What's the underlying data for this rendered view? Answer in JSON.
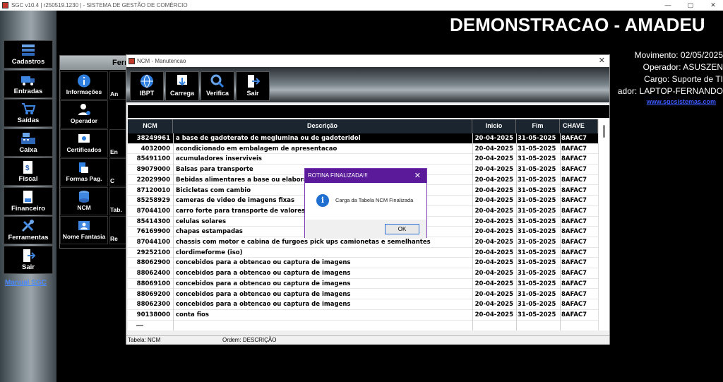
{
  "app": {
    "title": "SGC v10.4 | r250519.1230 | - SISTEMA DE GESTÃO DE COMÉRCIO",
    "win_controls": [
      "—",
      "▢",
      "✕"
    ]
  },
  "sidebar": {
    "items": [
      {
        "label": "Cadastros",
        "icon": "database-stack-icon"
      },
      {
        "label": "Entradas",
        "icon": "truck-icon"
      },
      {
        "label": "Saídas",
        "icon": "cart-icon"
      },
      {
        "label": "Caixa",
        "icon": "cash-register-icon"
      },
      {
        "label": "Fiscal",
        "icon": "fiscal-document-icon"
      },
      {
        "label": "Financeiro",
        "icon": "finance-document-icon"
      },
      {
        "label": "Ferramentas",
        "icon": "tools-icon"
      },
      {
        "label": "Sair",
        "icon": "exit-door-icon"
      }
    ],
    "manual_link": "Manual SGC"
  },
  "header": {
    "company": "DEMONSTRACAO - AMADEU",
    "movimento": "Movimento: 02/05/2025",
    "operador": "Operador: ASUSZEN",
    "cargo": "Cargo: Suporte de TI",
    "computador": "ador: LAPTOP-FERNANDO",
    "site": "www.sgcsistemas.com"
  },
  "ferramentas": {
    "title": "Ferr",
    "items": [
      {
        "label": "Informações",
        "side": "An"
      },
      {
        "label": "Operador",
        "side": ""
      },
      {
        "label": "Certificados",
        "side": "En"
      },
      {
        "label": "Formas Pag.",
        "side": "C"
      },
      {
        "label": "NCM",
        "side": "Tab."
      },
      {
        "label": "Nome Fantasia",
        "side": "Re"
      }
    ]
  },
  "ncm_window": {
    "title": "NCM - Manutencao",
    "close": "✕",
    "toolbar": [
      {
        "label": "IBPT",
        "icon": "globe-icon"
      },
      {
        "label": "Carrega",
        "icon": "download-icon"
      },
      {
        "label": "Verifica",
        "icon": "magnifier-icon"
      },
      {
        "label": "Sair",
        "icon": "exit-door-icon"
      }
    ],
    "columns": [
      "NCM",
      "Descrição",
      "Inicio",
      "Fim",
      "CHAVE"
    ],
    "rows": [
      [
        "38249961",
        "a base de gadoterato de meglumina ou de gadoteridol",
        "20-04-2025",
        "31-05-2025",
        "8AFAC7"
      ],
      [
        "4032000",
        "acondicionado em embalagem de apresentacao",
        "20-04-2025",
        "31-05-2025",
        "8AFAC7"
      ],
      [
        "85491100",
        "acumuladores inserviveis",
        "20-04-2025",
        "31-05-2025",
        "8AFAC7"
      ],
      [
        "89079000",
        "Balsas para transporte",
        "20-04-2025",
        "31-05-2025",
        "8AFAC7"
      ],
      [
        "22029900",
        "Bebidas alimentares a base ou elaborada",
        "20-04-2025",
        "31-05-2025",
        "8AFAC7"
      ],
      [
        "87120010",
        "Bicicletas com cambio",
        "20-04-2025",
        "31-05-2025",
        "8AFAC7"
      ],
      [
        "85258929",
        "cameras de video de imagens fixas",
        "20-04-2025",
        "31-05-2025",
        "8AFAC7"
      ],
      [
        "87044100",
        "carro forte para transporte de valores",
        "20-04-2025",
        "31-05-2025",
        "8AFAC7"
      ],
      [
        "85414300",
        "celulas solares",
        "20-04-2025",
        "31-05-2025",
        "8AFAC7"
      ],
      [
        "76169900",
        "chapas estampadas",
        "20-04-2025",
        "31-05-2025",
        "8AFAC7"
      ],
      [
        "87044100",
        "chassis com motor e cabina de furgoes pick ups camionetas e semelhantes",
        "20-04-2025",
        "31-05-2025",
        "8AFAC7"
      ],
      [
        "29252100",
        "clordimeforme (iso)",
        "20-04-2025",
        "31-05-2025",
        "8AFAC7"
      ],
      [
        "88062900",
        "concebidos para a obtencao ou captura de imagens",
        "20-04-2025",
        "31-05-2025",
        "8AFAC7"
      ],
      [
        "88062400",
        "concebidos para a obtencao ou captura de imagens",
        "20-04-2025",
        "31-05-2025",
        "8AFAC7"
      ],
      [
        "88069100",
        "concebidos para a obtencao ou captura de imagens",
        "20-04-2025",
        "31-05-2025",
        "8AFAC7"
      ],
      [
        "88069200",
        "concebidos para a obtencao ou captura de imagens",
        "20-04-2025",
        "31-05-2025",
        "8AFAC7"
      ],
      [
        "88062300",
        "concebidos para a obtencao ou captura de imagens",
        "20-04-2025",
        "31-05-2025",
        "8AFAC7"
      ],
      [
        "90138000",
        "conta fios",
        "20-04-2025",
        "31-05-2025",
        "8AFAC7"
      ]
    ],
    "status_table": "Tabela: NCM",
    "status_order": "Ordem: DESCRIÇÃO"
  },
  "dialog": {
    "title": "ROTINA FINALIZADA!!!",
    "message": "Carga da Tabela NCM Finalizada",
    "ok": "OK",
    "close": "✕",
    "icon_glyph": "i"
  },
  "colors": {
    "selected_row": "#000000",
    "dialog_title": "#5a1a9a",
    "link": "#3b5bff"
  }
}
